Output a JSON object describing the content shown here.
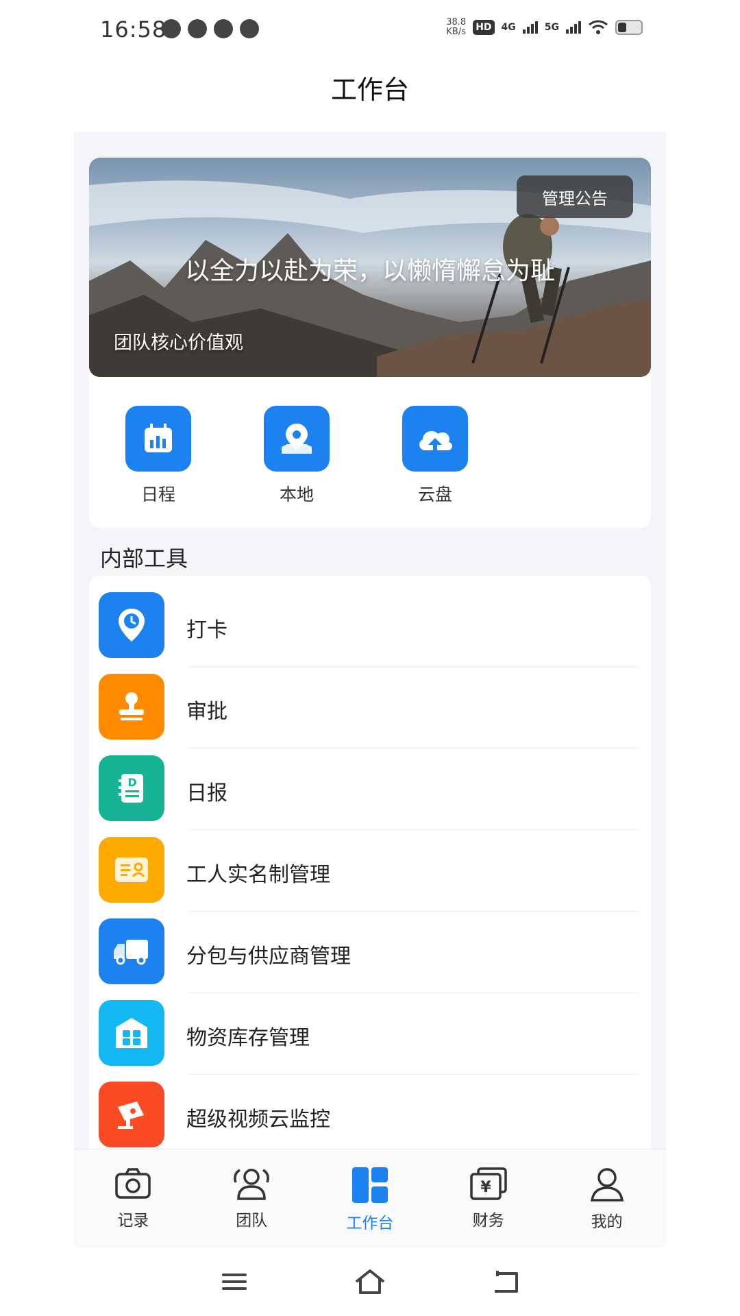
{
  "status_bar": {
    "time": "16:58",
    "net_speed_value": "38.8",
    "net_speed_unit": "KB/s",
    "hd_label": "HD",
    "sim1_label": "4G",
    "sim2_label": "5G"
  },
  "header": {
    "title": "工作台"
  },
  "banner": {
    "manage_button": "管理公告",
    "slogan": "以全力以赴为荣，以懒惰懈怠为耻",
    "subtitle": "团队核心价值观"
  },
  "quick_actions": [
    {
      "label": "日程",
      "icon": "calendar-icon",
      "color": "#1b82f0"
    },
    {
      "label": "本地",
      "icon": "location-icon",
      "color": "#1b82f0"
    },
    {
      "label": "云盘",
      "icon": "cloud-upload-icon",
      "color": "#1b82f0"
    }
  ],
  "internal_tools": {
    "title": "内部工具",
    "items": [
      {
        "label": "打卡",
        "icon": "clock-pin-icon",
        "color": "#1b82f0"
      },
      {
        "label": "审批",
        "icon": "stamp-icon",
        "color": "#ff8a00"
      },
      {
        "label": "日报",
        "icon": "report-icon",
        "color": "#15b394"
      },
      {
        "label": "工人实名制管理",
        "icon": "id-card-icon",
        "color": "#ffaa00"
      },
      {
        "label": "分包与供应商管理",
        "icon": "truck-icon",
        "color": "#1b82f0"
      },
      {
        "label": "物资库存管理",
        "icon": "warehouse-icon",
        "color": "#13b7f2"
      },
      {
        "label": "超级视频云监控",
        "icon": "camera-icon",
        "color": "#fb4b24"
      }
    ]
  },
  "tabbar": {
    "items": [
      {
        "label": "记录",
        "icon": "camera-icon"
      },
      {
        "label": "团队",
        "icon": "team-icon"
      },
      {
        "label": "工作台",
        "icon": "dashboard-icon",
        "active": true
      },
      {
        "label": "财务",
        "icon": "finance-icon"
      },
      {
        "label": "我的",
        "icon": "user-icon"
      }
    ],
    "active_color": "#1b82f0"
  }
}
